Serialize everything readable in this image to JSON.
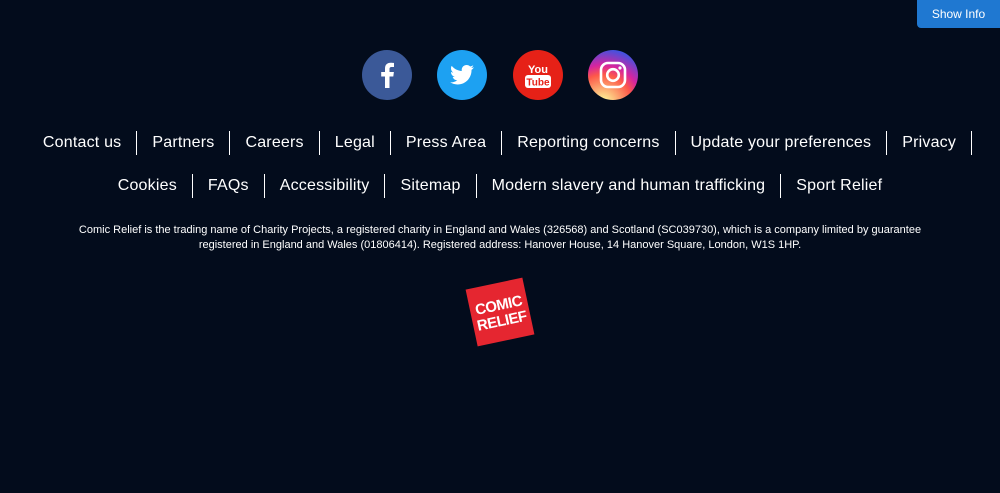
{
  "show_info": {
    "label": "Show Info",
    "color": "#1f78d1"
  },
  "social": [
    {
      "name": "facebook",
      "icon": "facebook-icon",
      "color": "#3b5998"
    },
    {
      "name": "twitter",
      "icon": "twitter-icon",
      "color": "#1da1f2"
    },
    {
      "name": "youtube",
      "icon": "youtube-icon",
      "color": "#e62117",
      "text": "You Tube"
    },
    {
      "name": "instagram",
      "icon": "instagram-icon",
      "color": "#d6249f"
    }
  ],
  "footer_links_row1": [
    "Contact us",
    "Partners",
    "Careers",
    "Legal",
    "Press Area",
    "Reporting concerns",
    "Update your preferences",
    "Privacy"
  ],
  "footer_links_row2": [
    "Cookies",
    "FAQs",
    "Accessibility",
    "Sitemap",
    "Modern slavery and human trafficking",
    "Sport Relief"
  ],
  "legal_text": {
    "line1": "Comic Relief is the trading name of Charity Projects, a registered charity in England and Wales (326568) and Scotland (SC039730), which is a company limited by guarantee",
    "line2": "registered in England and Wales (01806414). Registered address: Hanover House, 14 Hanover Square, London, W1S 1HP."
  },
  "logo": {
    "line1": "COMIC",
    "line2": "RELIEF",
    "color": "#e52630"
  },
  "background": "#030c1c"
}
